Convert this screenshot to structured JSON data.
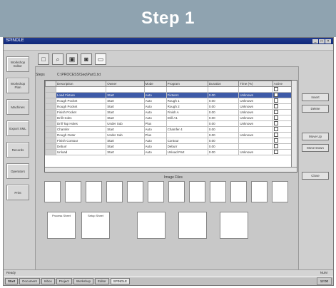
{
  "banner": {
    "title": "Step 1"
  },
  "window": {
    "title": "SPINDLE",
    "controls": [
      "_",
      "□",
      "×"
    ]
  },
  "sidebar": {
    "items": [
      {
        "label": "Workshop Editor"
      },
      {
        "label": "Workshop Plan"
      },
      {
        "label": "Machines"
      },
      {
        "label": "Export XML"
      },
      {
        "label": "Records"
      },
      {
        "label": "Operators"
      },
      {
        "label": "Print"
      }
    ]
  },
  "toolbar": {
    "buttons": [
      {
        "icon": "document-icon",
        "glyph": "□"
      },
      {
        "icon": "search-icon",
        "glyph": "⌕"
      },
      {
        "icon": "save-icon",
        "glyph": "▣"
      },
      {
        "icon": "camera-icon",
        "glyph": "◙"
      },
      {
        "icon": "export-icon",
        "glyph": "▭"
      }
    ]
  },
  "grid": {
    "section_label": "Steps",
    "caption": "C:\\PROCESS\\Seq\\Part1.txt",
    "columns": [
      "",
      "Description",
      "Owner",
      "Mode",
      "Program",
      "Duration",
      "Time (%)",
      "Active"
    ],
    "rows": [
      [
        "",
        "",
        "",
        "",
        "",
        "",
        "",
        ""
      ],
      [
        "",
        "Load Fixture",
        "Start",
        "Auto",
        "Fixture1",
        "0.00",
        "Unknown",
        ""
      ],
      [
        "",
        "Rough Pocket",
        "Start",
        "Auto",
        "Rough 1",
        "0.00",
        "Unknown",
        ""
      ],
      [
        "",
        "Rough Pocket",
        "Start",
        "Auto",
        "Rough 2",
        "0.00",
        "Unknown",
        ""
      ],
      [
        "",
        "Finish Pocket",
        "Start",
        "Auto",
        "Finish A",
        "0.00",
        "Unknown",
        ""
      ],
      [
        "",
        "Drill Holes",
        "Start",
        "Auto",
        "Drill A1",
        "0.00",
        "Unknown",
        ""
      ],
      [
        "",
        "Drill Tap Holes",
        "Under Sub",
        "Plus",
        "",
        "0.00",
        "Unknown",
        ""
      ],
      [
        "",
        "Chamfer",
        "Start",
        "Auto",
        "Chamfer 4",
        "0.00",
        "",
        ""
      ],
      [
        "",
        "Rough Outer",
        "Under Sub",
        "Plus",
        "",
        "0.00",
        "Unknown",
        ""
      ],
      [
        "",
        "Finish Contour",
        "Start",
        "Auto",
        "Contour",
        "0.00",
        "",
        ""
      ],
      [
        "",
        "Deburr",
        "Start",
        "Auto",
        "Deburr",
        "0.00",
        "",
        ""
      ],
      [
        "",
        "Unload",
        "Start",
        "Auto",
        "Unload Part",
        "0.00",
        "Unknown",
        ""
      ]
    ]
  },
  "right_buttons": {
    "items": [
      {
        "label": "Insert"
      },
      {
        "label": "Delete"
      },
      {
        "label": "Move Up"
      },
      {
        "label": "Move Down"
      },
      {
        "label": "Close"
      }
    ]
  },
  "images": {
    "label": "Image Files",
    "row1": [
      "",
      "",
      "",
      "",
      "",
      "",
      "",
      "",
      "",
      "",
      "",
      ""
    ],
    "row2": [
      {
        "title": "Process Sheet"
      },
      {
        "title": "Setup Sheet"
      },
      {
        "title": ""
      },
      {
        "title": ""
      },
      {
        "title": ""
      }
    ]
  },
  "statusbar": {
    "left": "Ready",
    "right": "NUM"
  },
  "taskbar": {
    "start": "Start",
    "tasks": [
      {
        "label": "Document"
      },
      {
        "label": "Inbox"
      },
      {
        "label": "Project"
      },
      {
        "label": "Workshop"
      },
      {
        "label": "Editor"
      },
      {
        "label": "SPINDLE"
      }
    ],
    "clock": "12:00"
  }
}
